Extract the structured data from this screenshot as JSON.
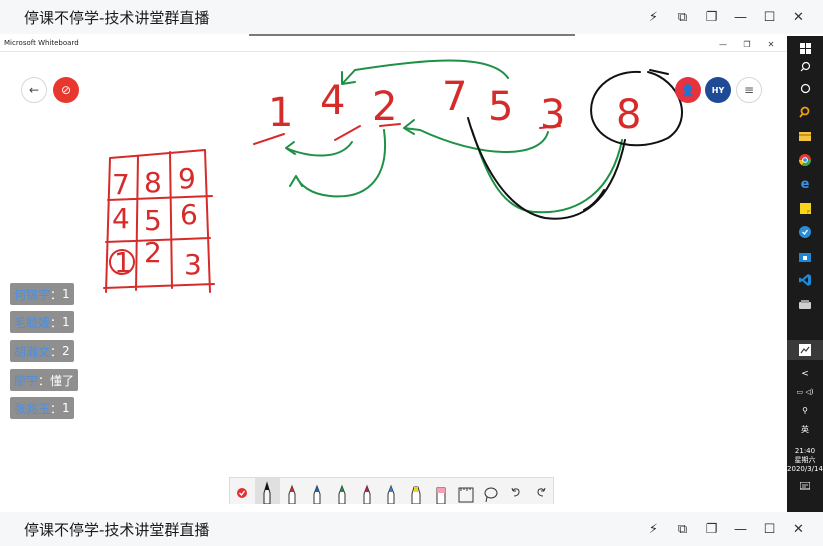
{
  "outer_window": {
    "title": "停课不停学-技术讲堂群直播",
    "controls": [
      "⚡",
      "⧉",
      "❐",
      "—",
      "☐",
      "✕"
    ]
  },
  "whiteboard": {
    "app_title": "Microsoft Whiteboard",
    "controls": [
      "—",
      "❐",
      "✕"
    ],
    "back_glyph": "←",
    "record_glyph": "⊘",
    "person_glyph": "👤",
    "user_initials": "HY",
    "menu_glyph": "≡"
  },
  "ink": {
    "row_digits": [
      "1",
      "4",
      "2",
      "7",
      "5",
      "3",
      "8"
    ],
    "grid_digits": [
      "7",
      "8",
      "9",
      "4",
      "5",
      "6",
      "1",
      "2",
      "3"
    ],
    "colors": {
      "red": "#d62b2b",
      "green": "#1e9146",
      "black": "#111111"
    }
  },
  "chat": [
    {
      "name": "何锦宇",
      "message": "1"
    },
    {
      "name": "毛毓娥",
      "message": "1"
    },
    {
      "name": "胡瀚文",
      "message": "2"
    },
    {
      "name": "廖宇",
      "message": "懂了"
    },
    {
      "name": "张兆玉",
      "message": "1"
    }
  ],
  "chat_separator": "：",
  "toolbar": {
    "tools": [
      "pen-black",
      "pen-red",
      "pen-blue",
      "pen-green",
      "pen-red-2",
      "pen-blue-2",
      "highlighter-yellow",
      "eraser-pink",
      "ruler",
      "lasso",
      "undo",
      "redo"
    ]
  },
  "taskbar": {
    "icons": [
      "windows",
      "search",
      "task-view",
      "search-orange",
      "file-explorer",
      "chrome",
      "edge",
      "sticky-notes",
      "app-blue",
      "store",
      "vscode",
      "onedrive",
      "whiteboard"
    ],
    "tray": {
      "chevron": "<",
      "language": "英",
      "time": "21:40",
      "weekday": "星期六",
      "date": "2020/3/14"
    }
  }
}
